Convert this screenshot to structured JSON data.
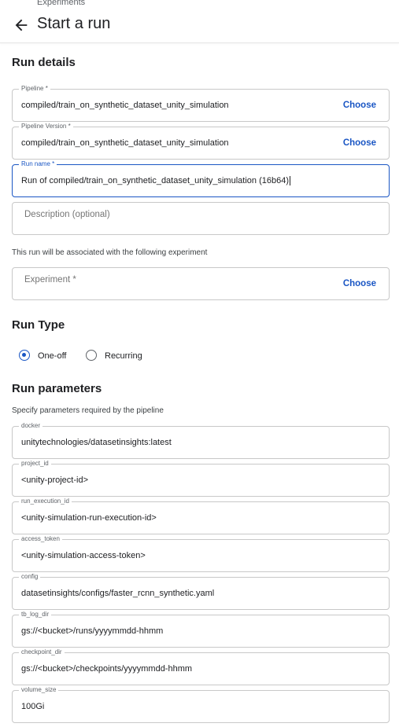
{
  "header": {
    "breadcrumb": "Experiments",
    "title": "Start a run"
  },
  "run_details": {
    "section_title": "Run details",
    "pipeline": {
      "label": "Pipeline *",
      "value": "compiled/train_on_synthetic_dataset_unity_simulation",
      "action": "Choose"
    },
    "pipeline_version": {
      "label": "Pipeline Version *",
      "value": "compiled/train_on_synthetic_dataset_unity_simulation",
      "action": "Choose"
    },
    "run_name": {
      "label": "Run name *",
      "value": "Run of compiled/train_on_synthetic_dataset_unity_simulation (16b64)"
    },
    "description": {
      "placeholder": "Description (optional)"
    },
    "experiment_helper": "This run will be associated with the following experiment",
    "experiment": {
      "placeholder": "Experiment *",
      "action": "Choose"
    }
  },
  "run_type": {
    "section_title": "Run Type",
    "options": [
      {
        "label": "One-off",
        "selected": true
      },
      {
        "label": "Recurring",
        "selected": false
      }
    ]
  },
  "run_parameters": {
    "section_title": "Run parameters",
    "helper": "Specify parameters required by the pipeline",
    "params": [
      {
        "label": "docker",
        "value": "unitytechnologies/datasetinsights:latest"
      },
      {
        "label": "project_id",
        "value": "<unity-project-id>"
      },
      {
        "label": "run_execution_id",
        "value": "<unity-simulation-run-execution-id>"
      },
      {
        "label": "access_token",
        "value": "<unity-simulation-access-token>"
      },
      {
        "label": "config",
        "value": "datasetinsights/configs/faster_rcnn_synthetic.yaml"
      },
      {
        "label": "tb_log_dir",
        "value": "gs://<bucket>/runs/yyyymmdd-hhmm"
      },
      {
        "label": "checkpoint_dir",
        "value": "gs://<bucket>/checkpoints/yyyymmdd-hhmm"
      },
      {
        "label": "volume_size",
        "value": "100Gi"
      }
    ]
  },
  "colors": {
    "accent": "#1a56c4",
    "border": "#c8c8c8"
  }
}
